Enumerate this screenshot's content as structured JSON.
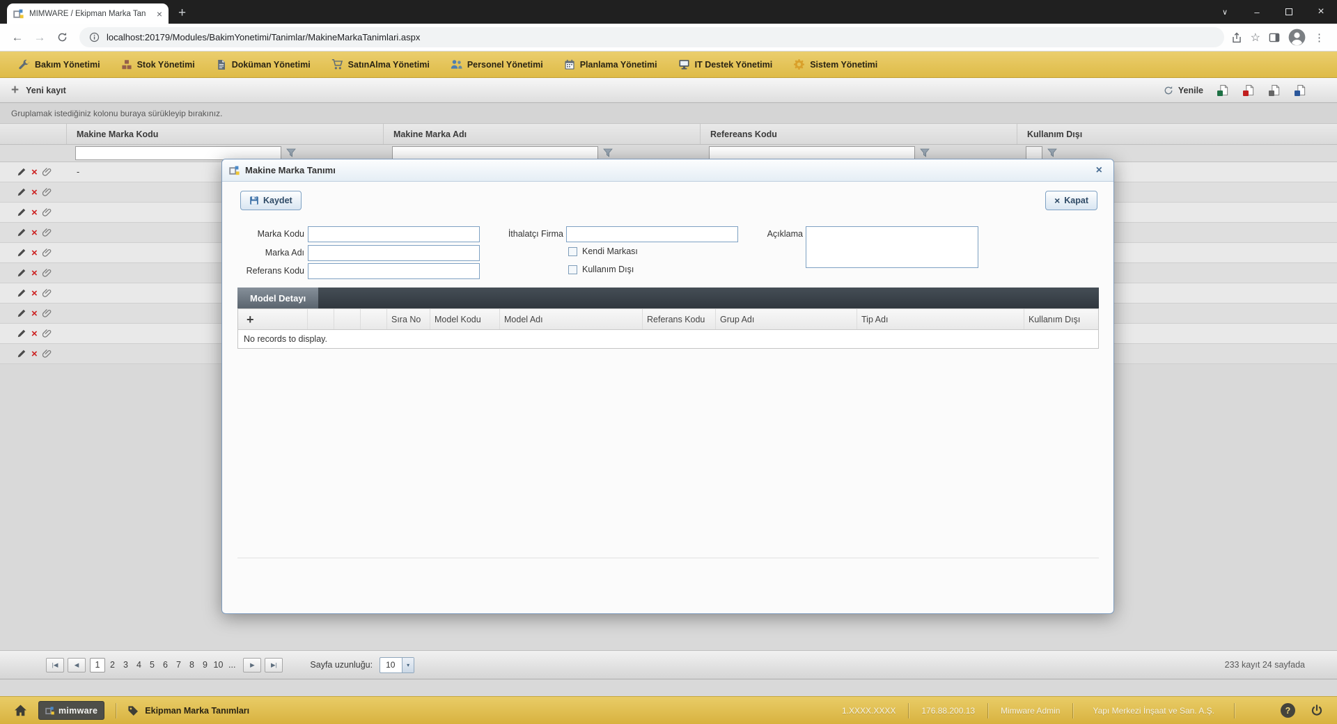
{
  "browser": {
    "tab_title": "MIMWARE / Ekipman Marka Tan",
    "url": "localhost:20179/Modules/BakimYonetimi/Tanimlar/MakineMarkaTanimlari.aspx"
  },
  "menubar": {
    "items": [
      {
        "label": "Bakım Yönetimi",
        "icon": "wrench-icon"
      },
      {
        "label": "Stok Yönetimi",
        "icon": "boxes-icon"
      },
      {
        "label": "Doküman Yönetimi",
        "icon": "document-icon"
      },
      {
        "label": "SatınAlma Yönetimi",
        "icon": "cart-icon"
      },
      {
        "label": "Personel Yönetimi",
        "icon": "people-icon"
      },
      {
        "label": "Planlama Yönetimi",
        "icon": "calendar-icon"
      },
      {
        "label": "IT Destek Yönetimi",
        "icon": "monitor-icon"
      },
      {
        "label": "Sistem Yönetimi",
        "icon": "gear-icon"
      }
    ]
  },
  "toolbar": {
    "new_record_label": "Yeni kayıt",
    "refresh_label": "Yenile"
  },
  "grid": {
    "group_hint": "Gruplamak istediğiniz kolonu buraya sürükleyip bırakınız.",
    "columns": [
      "Makine Marka Kodu",
      "Makine Marka Adı",
      "Refereans Kodu",
      "Kullanım Dışı"
    ],
    "first_row_value": "-"
  },
  "dialog": {
    "title": "Makine Marka Tanımı",
    "save_label": "Kaydet",
    "close_label": "Kapat",
    "fields": {
      "marka_kodu": "Marka Kodu",
      "marka_adi": "Marka Adı",
      "referans_kodu": "Referans Kodu",
      "ithalatci_firma": "İthalatçı Firma",
      "kendi_markasi": "Kendi Markası",
      "kullanim_disi": "Kullanım Dışı",
      "aciklama": "Açıklama"
    },
    "tab_label": "Model Detayı",
    "detail_columns": [
      "Sıra No",
      "Model Kodu",
      "Model Adı",
      "Referans Kodu",
      "Grup Adı",
      "Tip Adı",
      "Kullanım Dışı"
    ],
    "empty_text": "No records to display."
  },
  "pager": {
    "pages": [
      "1",
      "2",
      "3",
      "4",
      "5",
      "6",
      "7",
      "8",
      "9",
      "10"
    ],
    "ellipsis": "...",
    "current_page": "1",
    "page_size_label": "Sayfa uzunluğu:",
    "page_size_value": "10",
    "summary": "233 kayıt 24 sayfada"
  },
  "footer": {
    "logo_text": "mimware",
    "page_title": "Ekipman Marka Tanımları",
    "version": "1.XXXX.XXXX",
    "ip": "176.88.200.13",
    "user": "Mimware Admin",
    "company": "Yapı Merkezi İnşaat ve San. A.Ş."
  },
  "colors": {
    "gold": "#E4C45C",
    "dialog_border": "#7E9CBE",
    "accent_blue": "#3A6EA5",
    "delete_red": "#CC2222"
  }
}
